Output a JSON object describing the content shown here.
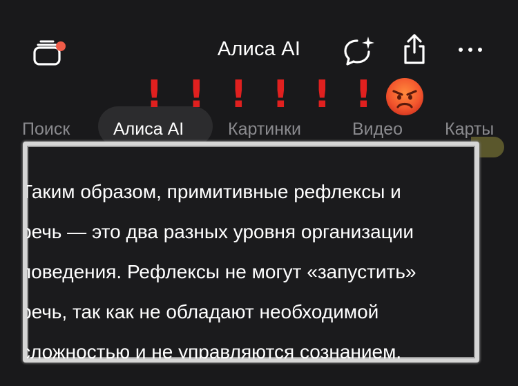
{
  "header": {
    "title": "Алиса AI",
    "icons": {
      "tabs": "tabs-stack-icon",
      "new_chat": "new-chat-sparkle-icon",
      "share": "share-icon",
      "more": "more-dots-icon"
    },
    "notification_dot_color": "#ef5b48"
  },
  "annotation": {
    "marks": [
      "!",
      "!",
      "!",
      "!",
      "!",
      "!"
    ],
    "mark_color": "#e0201f",
    "emoji": "angry-face-emoji"
  },
  "tabs": [
    {
      "label": "Поиск",
      "active": false
    },
    {
      "label": "Алиса AI",
      "active": true
    },
    {
      "label": "Картинки",
      "active": false
    },
    {
      "label": "Видео",
      "active": false
    },
    {
      "label": "Карты",
      "active": false
    }
  ],
  "answer": {
    "lines": [
      "Таким образом, примитивные рефлексы и",
      "речь — это два разных уровня организации",
      "поведения. Рефлексы не могут «запустить»",
      "речь, так как не обладают необходимой",
      "сложностью и не управляются сознанием."
    ]
  },
  "colors": {
    "background": "#19191b",
    "text": "#ffffff",
    "tab_inactive": "#8a8a8e",
    "tab_active_pill": "#2c2c2e",
    "highlight_border": "#d6d6d6"
  }
}
